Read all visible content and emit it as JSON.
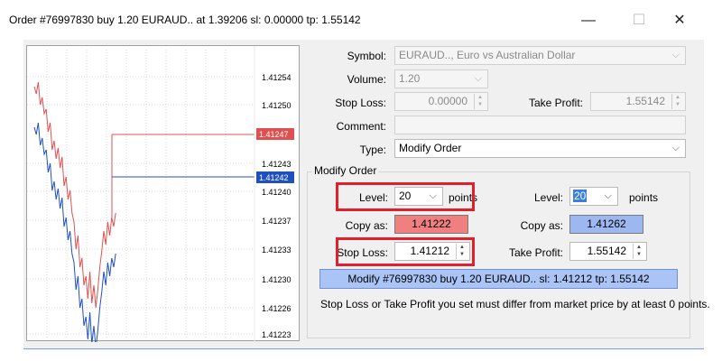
{
  "window": {
    "title": "Order #76997830 buy 1.20 EURAUD.. at 1.39206 sl: 0.00000 tp: 1.55142",
    "minimize": "—",
    "maximize": "☐",
    "close": "✕"
  },
  "chart": {
    "price_labels": [
      "1.41254",
      "1.41250",
      "1.41243",
      "1.41240",
      "1.41237",
      "1.41233",
      "1.41230",
      "1.41226",
      "1.41223"
    ],
    "ask_tag": "1.41247",
    "bid_tag": "1.41242",
    "ask_color": "#e05050",
    "bid_color": "#2050c0"
  },
  "form": {
    "symbol_label": "Symbol:",
    "symbol_value": "EURAUD.., Euro vs Australian Dollar",
    "volume_label": "Volume:",
    "volume_value": "1.20",
    "stoploss_label": "Stop Loss:",
    "stoploss_value": "0.00000",
    "takeprofit_label": "Take Profit:",
    "takeprofit_value": "1.55142",
    "comment_label": "Comment:",
    "comment_value": "",
    "type_label": "Type:",
    "type_value": "Modify Order"
  },
  "modify": {
    "group_title": "Modify Order",
    "left": {
      "level_label": "Level:",
      "level_value": "20",
      "points_label": "points",
      "copy_label": "Copy as:",
      "copy_value": "1.41222",
      "sl_label": "Stop Loss:",
      "sl_value": "1.41212"
    },
    "right": {
      "level_label": "Level:",
      "level_value": "20",
      "points_label": "points",
      "copy_label": "Copy as:",
      "copy_value": "1.41262",
      "tp_label": "Take Profit:",
      "tp_value": "1.55142"
    },
    "button_label": "Modify #76997830 buy 1.20 EURAUD.. sl: 1.41212 tp: 1.55142",
    "note": "Stop Loss or Take Profit you set must differ from market price by at least 0 points."
  },
  "icons": {
    "dropdown": "⌵",
    "spin_up": "▲",
    "spin_down": "▼"
  }
}
